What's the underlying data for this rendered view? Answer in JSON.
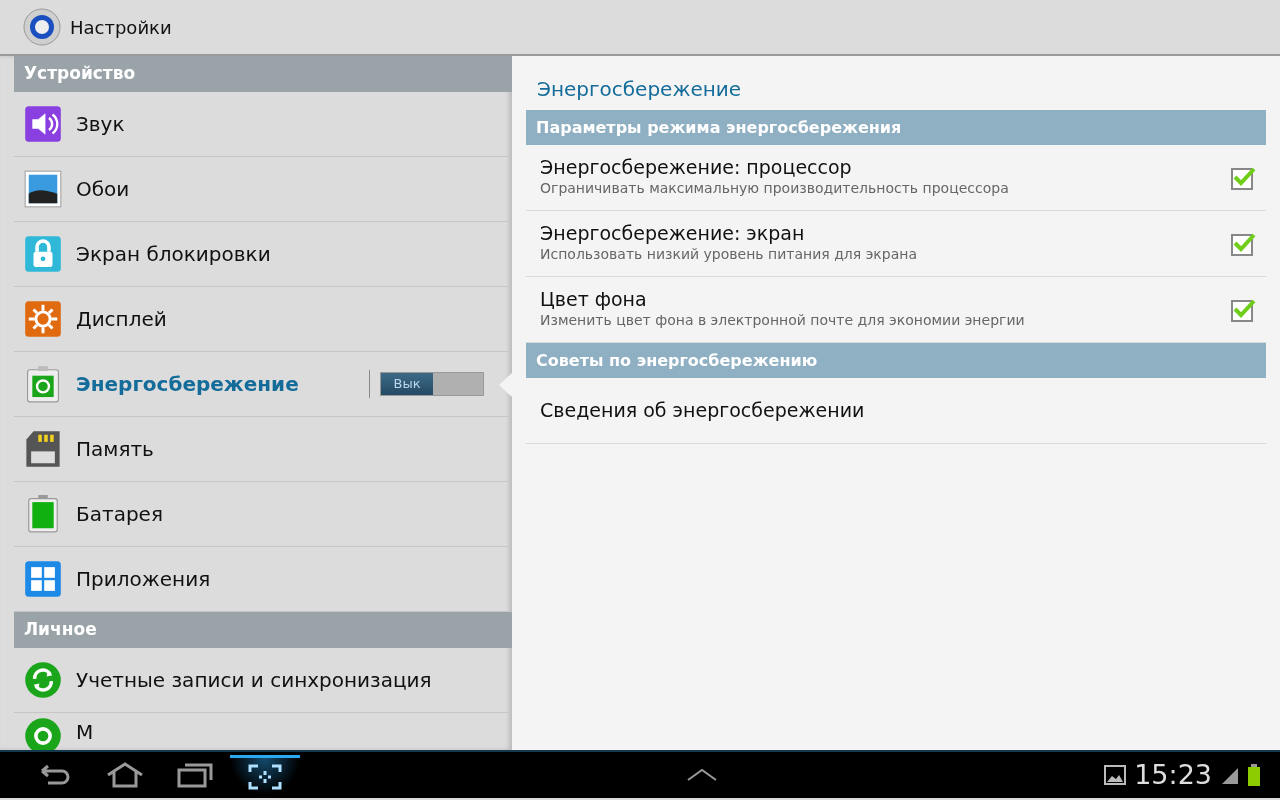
{
  "app_bar": {
    "title": "Настройки"
  },
  "sidebar": {
    "sections": [
      {
        "title": "Устройство",
        "items": [
          {
            "label": "Звук",
            "selected": false
          },
          {
            "label": "Обои",
            "selected": false
          },
          {
            "label": "Экран блокировки",
            "selected": false
          },
          {
            "label": "Дисплей",
            "selected": false
          },
          {
            "label": "Энергосбережение",
            "selected": true,
            "switch": {
              "label": "Вык",
              "on": false
            }
          },
          {
            "label": "Память",
            "selected": false
          },
          {
            "label": "Батарея",
            "selected": false
          },
          {
            "label": "Приложения",
            "selected": false
          }
        ]
      },
      {
        "title": "Личное",
        "items": [
          {
            "label": "Учетные записи и синхронизация",
            "selected": false
          },
          {
            "label": "М",
            "selected": false
          }
        ]
      }
    ]
  },
  "detail": {
    "title": "Энергосбережение",
    "groups": [
      {
        "title": "Параметры режима энергосбережения",
        "items": [
          {
            "title": "Энергосбережение: процессор",
            "summary": "Ограничивать максимальную производительность процессора",
            "checked": true
          },
          {
            "title": "Энергосбережение: экран",
            "summary": "Использовать низкий уровень питания для экрана",
            "checked": true
          },
          {
            "title": "Цвет фона",
            "summary": "Изменить цвет фона в электронной почте для экономии энергии",
            "checked": true
          }
        ]
      },
      {
        "title": "Советы по энергосбережению",
        "items": [
          {
            "title": "Сведения об энергосбережении"
          }
        ]
      }
    ]
  },
  "status_bar": {
    "time": "15:23"
  }
}
